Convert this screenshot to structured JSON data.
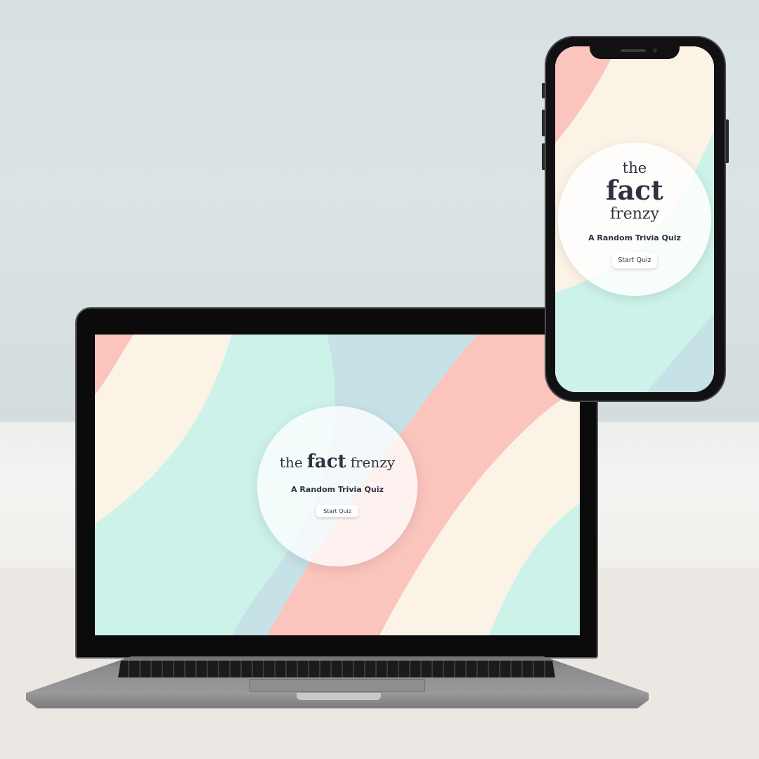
{
  "app": {
    "title_the": "the",
    "title_fact": "fact",
    "title_frenzy": "frenzy",
    "subtitle": "A Random Trivia Quiz",
    "start_button_label": "Start Quiz"
  },
  "colors": {
    "coral": "#fbc4bd",
    "cream": "#fbf4e6",
    "mint": "#cdf2ea",
    "powder_blue": "#c6e2e7",
    "text_dark": "#2f3141",
    "wall": "#d8e1e4",
    "desk": "#ebe7e2"
  },
  "icons": {
    "phone_camera": "camera-icon",
    "phone_speaker": "speaker-icon"
  }
}
